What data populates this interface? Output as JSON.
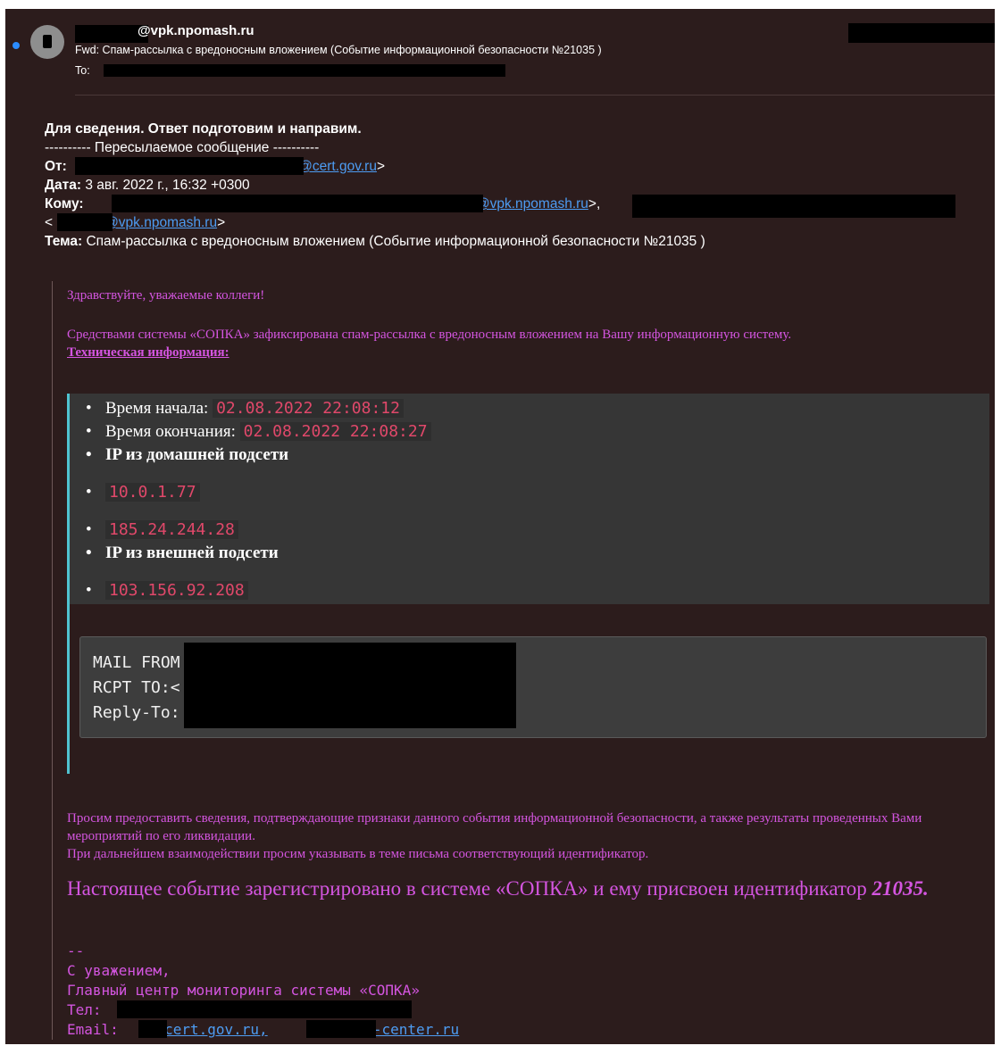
{
  "header": {
    "from_domain": "@vpk.npomash.ru",
    "subject": "Fwd: Спам-рассылка с вредоносным вложением (Событие информационной безопасности №21035 )",
    "to_label": "To:"
  },
  "forward": {
    "intro": "Для сведения. Ответ подготовим и направим.",
    "separator": "---------- Пересылаемое сообщение ----------",
    "from_label": "От:",
    "from_email": "@cert.gov.ru",
    "date_label": "Дата:",
    "date_value": "3 авг. 2022 г., 16:32 +0300",
    "to_label": "Кому:",
    "to_email1": "@vpk.npomash.ru",
    "to_email2": "@vpk.npomash.ru",
    "subject_label": "Тема:",
    "subject_value": "Спам-рассылка с вредоносным вложением (Событие информационной безопасности №21035 )"
  },
  "body": {
    "greeting": "Здравствуйте, уважаемые коллеги!",
    "p1": "Средствами системы «СОПКА» зафиксирована спам-рассылка с вредоносным вложением на Вашу информационную систему.",
    "tech_info": "Техническая информация:",
    "start_label": "Время начала:",
    "start_value": "02.08.2022 22:08:12",
    "end_label": "Время окончания:",
    "end_value": "02.08.2022 22:08:27",
    "home_subnet_label": "IP из домашней подсети",
    "home_ips": [
      "10.0.1.77",
      "185.24.244.28"
    ],
    "external_subnet_label": "IP из внешней подсети",
    "external_ips": [
      "103.156.92.208"
    ],
    "mail_from": "MAIL FROM",
    "rcpt_to": "RCPT TO:<",
    "reply_to": "Reply-To:",
    "p2_line1": "Просим предоставить сведения, подтверждающие признаки данного события информационной безопасности, а также результаты проведенных Вами мероприятий по его ликвидации.",
    "p2_line2": "При дальнейшем взаимодействии просим указывать в теме письма соответствующий идентификатор.",
    "registered": "Настоящее событие зарегистрировано в системе «СОПКА» и ему присвоен идентификатор",
    "event_id": "21035."
  },
  "signature": {
    "dashes": "--",
    "regards": "С уважением,",
    "org": "Главный центр мониторинга системы «СОПКА»",
    "tel_label": "Тел:",
    "email_label": "Email:",
    "email1": "@cert.gov.ru,",
    "email2": "@avz-center.ru"
  },
  "colors": {
    "background": "#2c1c1c",
    "quote_text": "#d455e0",
    "link": "#4d9cf2",
    "code_value": "#e0486a",
    "accent_bar": "#4fc3d0"
  }
}
